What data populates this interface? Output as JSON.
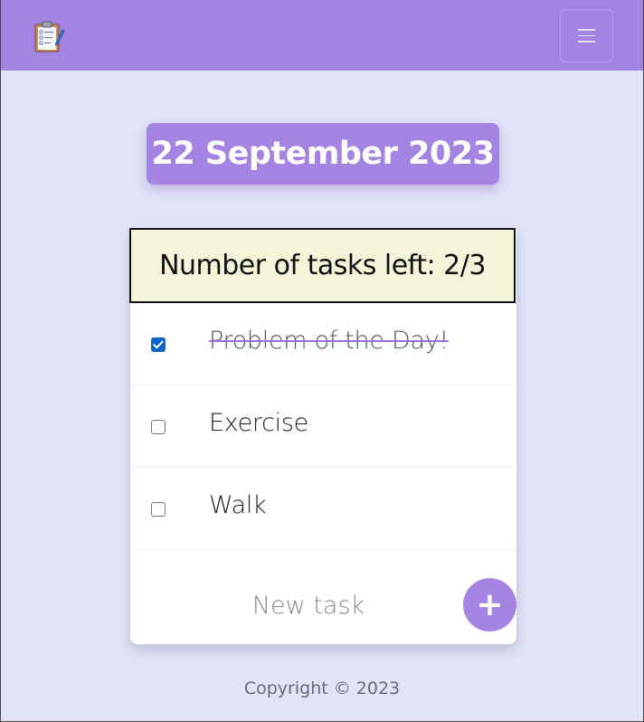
{
  "navbar": {
    "logo_icon": "clipboard-checklist-icon",
    "menu_icon": "hamburger-menu-icon",
    "accent": "#a583e3"
  },
  "date": "22 September 2023",
  "tasks_left": "Number of tasks left: 2/3",
  "tasks": [
    {
      "label": "Problem of the Day!",
      "done": true
    },
    {
      "label": "Exercise",
      "done": false
    },
    {
      "label": "Walk",
      "done": false
    }
  ],
  "new_task": {
    "placeholder": "New task",
    "value": ""
  },
  "add_button": "+",
  "footer": "Copyright © 2023"
}
